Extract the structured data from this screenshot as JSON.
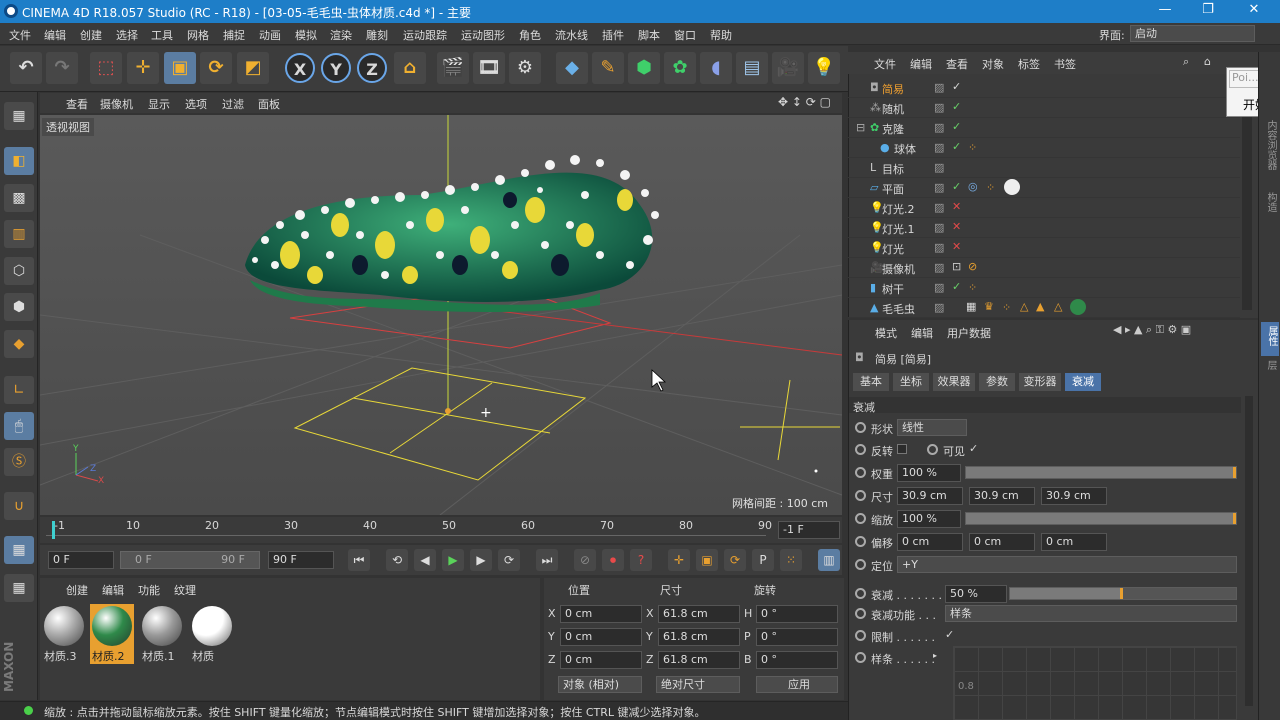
{
  "window": {
    "title": "CINEMA 4D R18.057 Studio (RC - R18) - [03-05-毛毛虫-虫体材质.c4d *] - 主要",
    "minimize_icon": "minimize-icon",
    "maximize_icon": "restore-icon",
    "close_icon": "close-icon"
  },
  "menubar": {
    "items": [
      "文件",
      "编辑",
      "创建",
      "选择",
      "工具",
      "网格",
      "捕捉",
      "动画",
      "模拟",
      "渲染",
      "雕刻",
      "运动跟踪",
      "运动图形",
      "角色",
      "流水线",
      "插件",
      "脚本",
      "窗口",
      "帮助"
    ],
    "layout_label": "界面:",
    "layout_value": "启动"
  },
  "viewport": {
    "menu": [
      "查看",
      "摄像机",
      "显示",
      "选项",
      "过滤",
      "面板"
    ],
    "view_name": "透视视图",
    "grid_text": "网格间距 : 100 cm"
  },
  "timeline": {
    "ticks": [
      "-1",
      "10",
      "20",
      "30",
      "40",
      "50",
      "60",
      "70",
      "80",
      "90"
    ],
    "current_field": "-1 F"
  },
  "transport": {
    "start_field": "0 F",
    "range_left": "0 F",
    "range_right": "90 F",
    "end_field": "90 F"
  },
  "materials": {
    "menu": [
      "创建",
      "编辑",
      "功能",
      "纹理"
    ],
    "items": [
      {
        "name": "材质.3",
        "color": "#a8a8a8"
      },
      {
        "name": "材质.2",
        "color": "#2f8a4a"
      },
      {
        "name": "材质.1",
        "color": "#9a9a9a"
      },
      {
        "name": "材质",
        "color": "#ffffff"
      }
    ]
  },
  "coords": {
    "headers": [
      "位置",
      "尺寸",
      "旋转"
    ],
    "rows": [
      {
        "axis": "X",
        "pos": "0 cm",
        "saxis": "X",
        "size": "61.8 cm",
        "raxis": "H",
        "rot": "0 °"
      },
      {
        "axis": "Y",
        "pos": "0 cm",
        "saxis": "Y",
        "size": "61.8 cm",
        "raxis": "P",
        "rot": "0 °"
      },
      {
        "axis": "Z",
        "pos": "0 cm",
        "saxis": "Z",
        "size": "61.8 cm",
        "raxis": "B",
        "rot": "0 °"
      }
    ],
    "mode": "对象 (相对)",
    "size_mode": "绝对尺寸",
    "apply": "应用"
  },
  "status": "缩放 : 点击并拖动鼠标缩放元素。按住 SHIFT 键量化缩放；节点编辑模式时按住 SHIFT 键增加选择对象；按住 CTRL 键减少选择对象。",
  "objects": {
    "menu": [
      "文件",
      "编辑",
      "查看",
      "对象",
      "标签",
      "书签"
    ],
    "rows": [
      {
        "name": "简易",
        "highlight": true,
        "indent": 0
      },
      {
        "name": "随机",
        "highlight": false,
        "indent": 0
      },
      {
        "name": "克隆",
        "highlight": false,
        "indent": 0
      },
      {
        "name": "球体",
        "highlight": false,
        "indent": 1
      },
      {
        "name": "目标",
        "highlight": false,
        "indent": 0
      },
      {
        "name": "平面",
        "highlight": false,
        "indent": 0
      },
      {
        "name": "灯光.2",
        "highlight": false,
        "indent": 0
      },
      {
        "name": "灯光.1",
        "highlight": false,
        "indent": 0
      },
      {
        "name": "灯光",
        "highlight": false,
        "indent": 0
      },
      {
        "name": "摄像机",
        "highlight": false,
        "indent": 0
      },
      {
        "name": "树干",
        "highlight": false,
        "indent": 0
      },
      {
        "name": "毛毛虫",
        "highlight": false,
        "indent": 0
      }
    ]
  },
  "popup": {
    "field": "Poi...",
    "button": "开始"
  },
  "attributes": {
    "menu": [
      "模式",
      "编辑",
      "用户数据"
    ],
    "object_title": "简易 [简易]",
    "tabs": [
      "基本",
      "坐标",
      "效果器",
      "参数",
      "变形器",
      "衰减"
    ],
    "selected_tab": "衰减",
    "section": "衰减",
    "shape_label": "形状",
    "shape_value": "线性",
    "invert_label": "反转",
    "visible_label": "可见",
    "weight_label": "权重",
    "weight_value": "100 %",
    "weight_level": 1.0,
    "size_label": "尺寸",
    "size_values": [
      "30.9 cm",
      "30.9 cm",
      "30.9 cm"
    ],
    "scale_label": "缩放",
    "scale_value": "100 %",
    "offset_label": "偏移",
    "offset_values": [
      "0 cm",
      "0 cm",
      "0 cm"
    ],
    "orient_label": "定位",
    "orient_value": "+Y",
    "falloff_label": "衰减 . . . . . . .",
    "falloff_value": "50 %",
    "falloff_level": 0.5,
    "falloff_fn_label": "衰减功能 . . .",
    "falloff_fn_value": "样条",
    "clamp_label": "限制 . . . . . .",
    "spline_label": "样条 . . . . . .",
    "spline_tick": "0.8"
  },
  "right_strip": [
    "内容浏览器",
    "构造",
    "属性",
    "层"
  ]
}
